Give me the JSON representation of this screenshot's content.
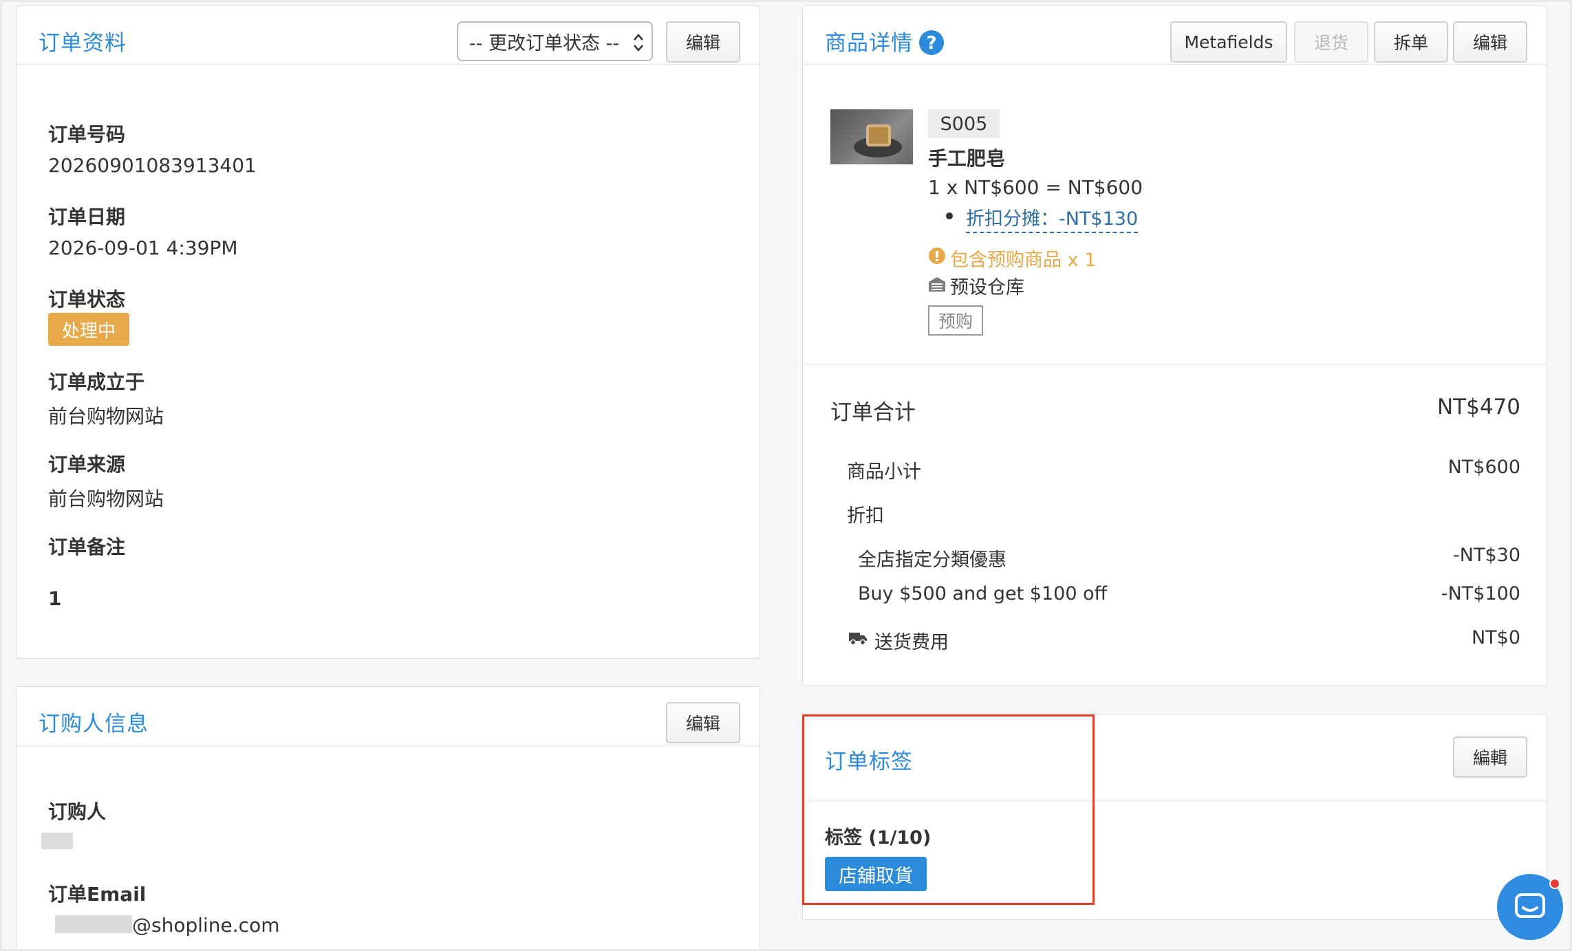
{
  "order_info": {
    "title": "订单资料",
    "status_select": "-- 更改订单状态 --",
    "edit_label": "编辑",
    "fields": {
      "order_no_label": "订单号码",
      "order_no": "20260901083913401",
      "order_date_label": "订单日期",
      "order_date": "2026-09-01 4:39PM",
      "order_status_label": "订单状态",
      "order_status": "处理中",
      "created_at_label": "订单成立于",
      "created_at": "前台购物网站",
      "source_label": "订单来源",
      "source": "前台购物网站",
      "remarks_label": "订单备注",
      "remarks": "1"
    }
  },
  "buyer_info": {
    "title": "订购人信息",
    "edit_label": "编辑",
    "buyer_label": "订购人",
    "email_label": "订单Email",
    "email_suffix": "@shopline.com"
  },
  "product_details": {
    "title": "商品详情",
    "buttons": {
      "metafields": "Metafields",
      "return": "退货",
      "split": "拆单",
      "edit": "编辑"
    },
    "item": {
      "sku": "S005",
      "name": "手工肥皂",
      "price_line": "1 x NT$600 = NT$600",
      "discount_allocation": "折扣分摊：-NT$130",
      "preorder_warning": "包含预购商品 x 1",
      "warehouse": "预设仓库",
      "preorder_tag": "预购"
    }
  },
  "order_total": {
    "label": "订单合计",
    "value": "NT$470",
    "subtotal_label": "商品小计",
    "subtotal_value": "NT$600",
    "discount_label": "折扣",
    "discount_1_label": "全店指定分類優惠",
    "discount_1_value": "-NT$30",
    "discount_2_label": "Buy $500 and get $100 off",
    "discount_2_value": "-NT$100",
    "shipping_label": "送货费用",
    "shipping_value": "NT$0"
  },
  "order_tags": {
    "title": "订单标签",
    "edit_label": "編輯",
    "count_label": "标签 (1/10)",
    "tags": [
      "店舖取貨"
    ]
  },
  "colors": {
    "accent": "#2b8ad9",
    "status_badge": "#e8a94a",
    "warning": "#e8a94a",
    "highlight": "#e0412f"
  }
}
